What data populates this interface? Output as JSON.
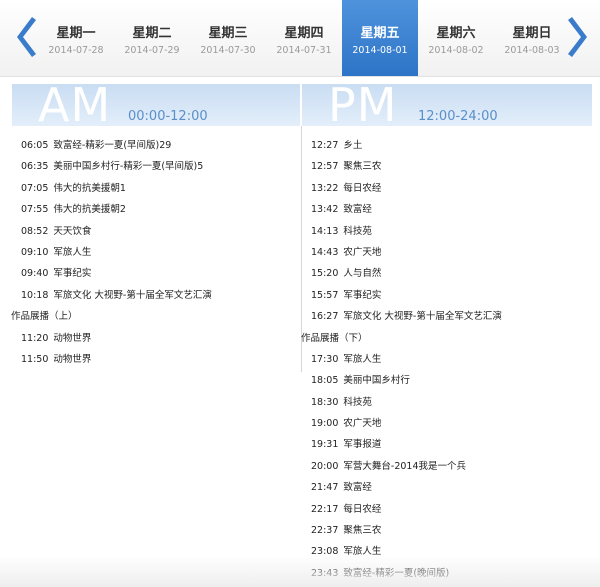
{
  "colors": {
    "accent": "#2d74c7",
    "header_bg": "#d6e6f7",
    "arrow": "#3a7ccb"
  },
  "nav": {
    "prev_icon": "chevron-left-icon",
    "next_icon": "chevron-right-icon",
    "days": [
      {
        "weekday": "星期一",
        "date": "2014-07-28",
        "active": false
      },
      {
        "weekday": "星期二",
        "date": "2014-07-29",
        "active": false
      },
      {
        "weekday": "星期三",
        "date": "2014-07-30",
        "active": false
      },
      {
        "weekday": "星期四",
        "date": "2014-07-31",
        "active": false
      },
      {
        "weekday": "星期五",
        "date": "2014-08-01",
        "active": true
      },
      {
        "weekday": "星期六",
        "date": "2014-08-02",
        "active": false
      },
      {
        "weekday": "星期日",
        "date": "2014-08-03",
        "active": false
      }
    ]
  },
  "am": {
    "label": "AM",
    "range": "00:00-12:00",
    "programs": [
      {
        "time": "06:05",
        "title": "致富经-精彩一夏(早间版)29"
      },
      {
        "time": "06:35",
        "title": "美丽中国乡村行-精彩一夏(早间版)5"
      },
      {
        "time": "07:05",
        "title": "伟大的抗美援朝1"
      },
      {
        "time": "07:55",
        "title": "伟大的抗美援朝2"
      },
      {
        "time": "08:52",
        "title": "天天饮食"
      },
      {
        "time": "09:10",
        "title": "军旅人生"
      },
      {
        "time": "09:40",
        "title": "军事纪实"
      },
      {
        "time": "10:18",
        "title": "军旅文化 大视野-第十届全军文艺汇演"
      },
      {
        "time": "",
        "title": "作品展播（上）"
      },
      {
        "time": "11:20",
        "title": "动物世界"
      },
      {
        "time": "11:50",
        "title": "动物世界"
      }
    ]
  },
  "pm": {
    "label": "PM",
    "range": "12:00-24:00",
    "programs": [
      {
        "time": "12:27",
        "title": "乡土"
      },
      {
        "time": "12:57",
        "title": "聚焦三农"
      },
      {
        "time": "13:22",
        "title": "每日农经"
      },
      {
        "time": "13:42",
        "title": "致富经"
      },
      {
        "time": "14:13",
        "title": "科技苑"
      },
      {
        "time": "14:43",
        "title": "农广天地"
      },
      {
        "time": "15:20",
        "title": "人与自然"
      },
      {
        "time": "15:57",
        "title": "军事纪实"
      },
      {
        "time": "16:27",
        "title": "军旅文化 大视野-第十届全军文艺汇演"
      },
      {
        "time": "",
        "title": "作品展播（下）"
      },
      {
        "time": "17:30",
        "title": "军旅人生"
      },
      {
        "time": "18:05",
        "title": "美丽中国乡村行"
      },
      {
        "time": "18:30",
        "title": "科技苑"
      },
      {
        "time": "19:00",
        "title": "农广天地"
      },
      {
        "time": "19:31",
        "title": "军事报道"
      },
      {
        "time": "20:00",
        "title": "军营大舞台-2014我是一个兵"
      },
      {
        "time": "21:47",
        "title": "致富经"
      },
      {
        "time": "22:17",
        "title": "每日农经"
      },
      {
        "time": "22:37",
        "title": "聚焦三农"
      },
      {
        "time": "23:08",
        "title": "军旅人生"
      },
      {
        "time": "23:43",
        "title": "致富经-精彩一夏(晚间版)"
      }
    ]
  }
}
